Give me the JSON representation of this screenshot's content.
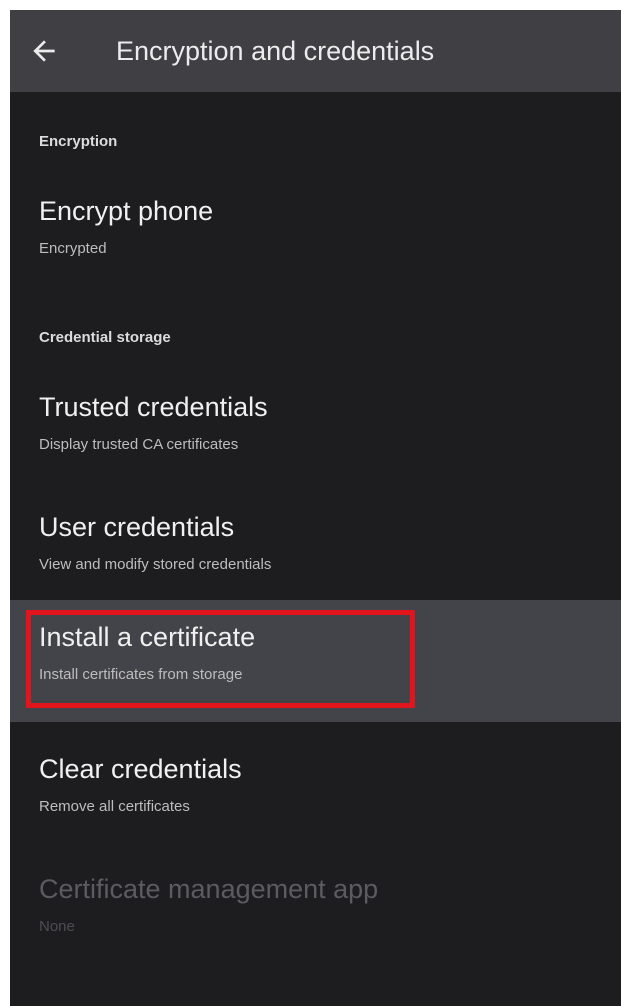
{
  "app_bar": {
    "title": "Encryption and credentials",
    "back_icon": "arrow-back-icon"
  },
  "sections": {
    "encryption": {
      "header": "Encryption",
      "encrypt_phone": {
        "title": "Encrypt phone",
        "subtitle": "Encrypted"
      }
    },
    "credential_storage": {
      "header": "Credential storage",
      "trusted": {
        "title": "Trusted credentials",
        "subtitle": "Display trusted CA certificates"
      },
      "user": {
        "title": "User credentials",
        "subtitle": "View and modify stored credentials"
      },
      "install": {
        "title": "Install a certificate",
        "subtitle": "Install certificates from storage",
        "selected": true
      },
      "clear": {
        "title": "Clear credentials",
        "subtitle": "Remove all certificates"
      },
      "cert_app": {
        "title": "Certificate management app",
        "subtitle": "None",
        "disabled": true
      }
    }
  },
  "colors": {
    "background": "#1d1d20",
    "app_bar": "#3f3f44",
    "selected_row": "#43434a",
    "highlight_border": "#e2141c"
  }
}
